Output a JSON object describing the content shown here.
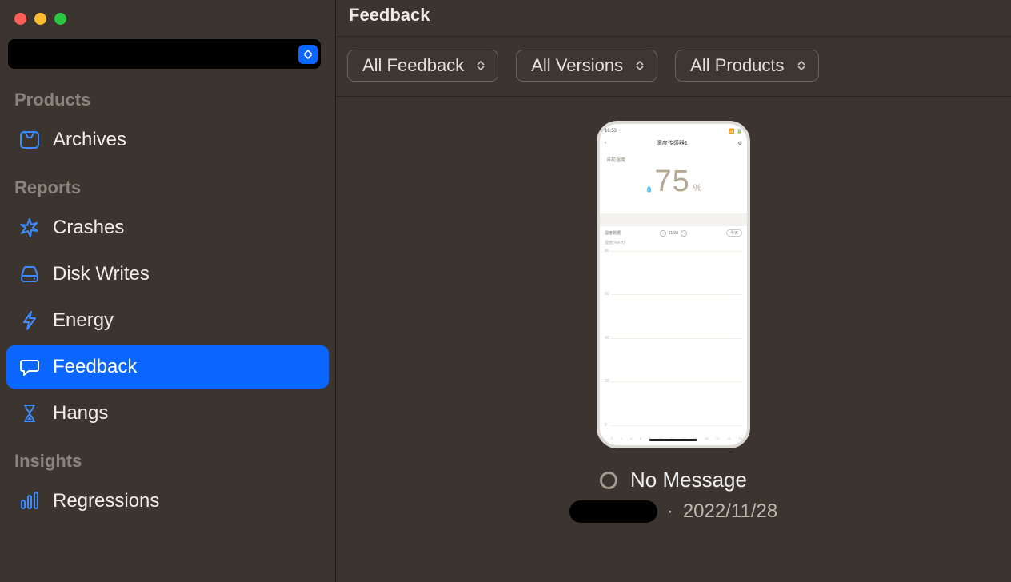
{
  "header": {
    "title": "Feedback"
  },
  "filters": {
    "feedback": "All Feedback",
    "versions": "All Versions",
    "products": "All Products"
  },
  "sidebar": {
    "sections": {
      "products": "Products",
      "reports": "Reports",
      "insights": "Insights"
    },
    "items": {
      "archives": "Archives",
      "crashes": "Crashes",
      "diskwrites": "Disk Writes",
      "energy": "Energy",
      "feedback": "Feedback",
      "hangs": "Hangs",
      "regressions": "Regressions"
    }
  },
  "feedback_item": {
    "status_label": "No Message",
    "date": "2022/11/28",
    "separator": "·"
  },
  "phone": {
    "clock": "16:53",
    "page_title": "湿度传感器1",
    "metric_label": "当前湿度",
    "metric_value": "75",
    "metric_unit": "%",
    "history_label": "湿度数据",
    "date_text": "11/28",
    "today_chip": "今天",
    "scale_label": "湿度(%RH)",
    "y_ticks": [
      "80",
      "60",
      "40",
      "20",
      "0"
    ],
    "x_ticks": [
      "0",
      "2",
      "4",
      "6",
      "8",
      "10",
      "12",
      "14",
      "16",
      "18",
      "20",
      "22",
      "24"
    ]
  }
}
